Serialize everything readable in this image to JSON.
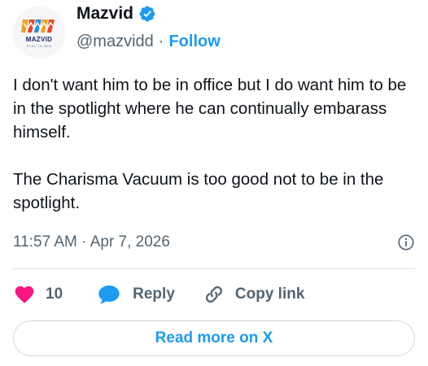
{
  "author": {
    "display_name": "Mazvid",
    "handle": "@mazvidd",
    "separator": "·",
    "follow_label": "Follow",
    "verified": true,
    "avatar_logo_text": "MAZVID",
    "avatar_logo_sub": "PLAY TO WIN"
  },
  "tweet": {
    "text": "I don't want him to be in office but I do want him to be in the spotlight where he can continually embarass himself.\n\nThe Charisma Vacuum is too good not to be in the spotlight.",
    "timestamp": "11:57 AM · Apr 7, 2026"
  },
  "actions": {
    "like_count": "10",
    "reply_label": "Reply",
    "copy_link_label": "Copy link"
  },
  "footer": {
    "read_more_label": "Read more on X"
  },
  "colors": {
    "accent": "#1d9bf0",
    "like": "#f91880",
    "text_primary": "#0f1419",
    "text_secondary": "#536471"
  },
  "icons": [
    "verified-badge-icon",
    "info-icon",
    "heart-icon",
    "reply-bubble-icon",
    "link-icon"
  ]
}
